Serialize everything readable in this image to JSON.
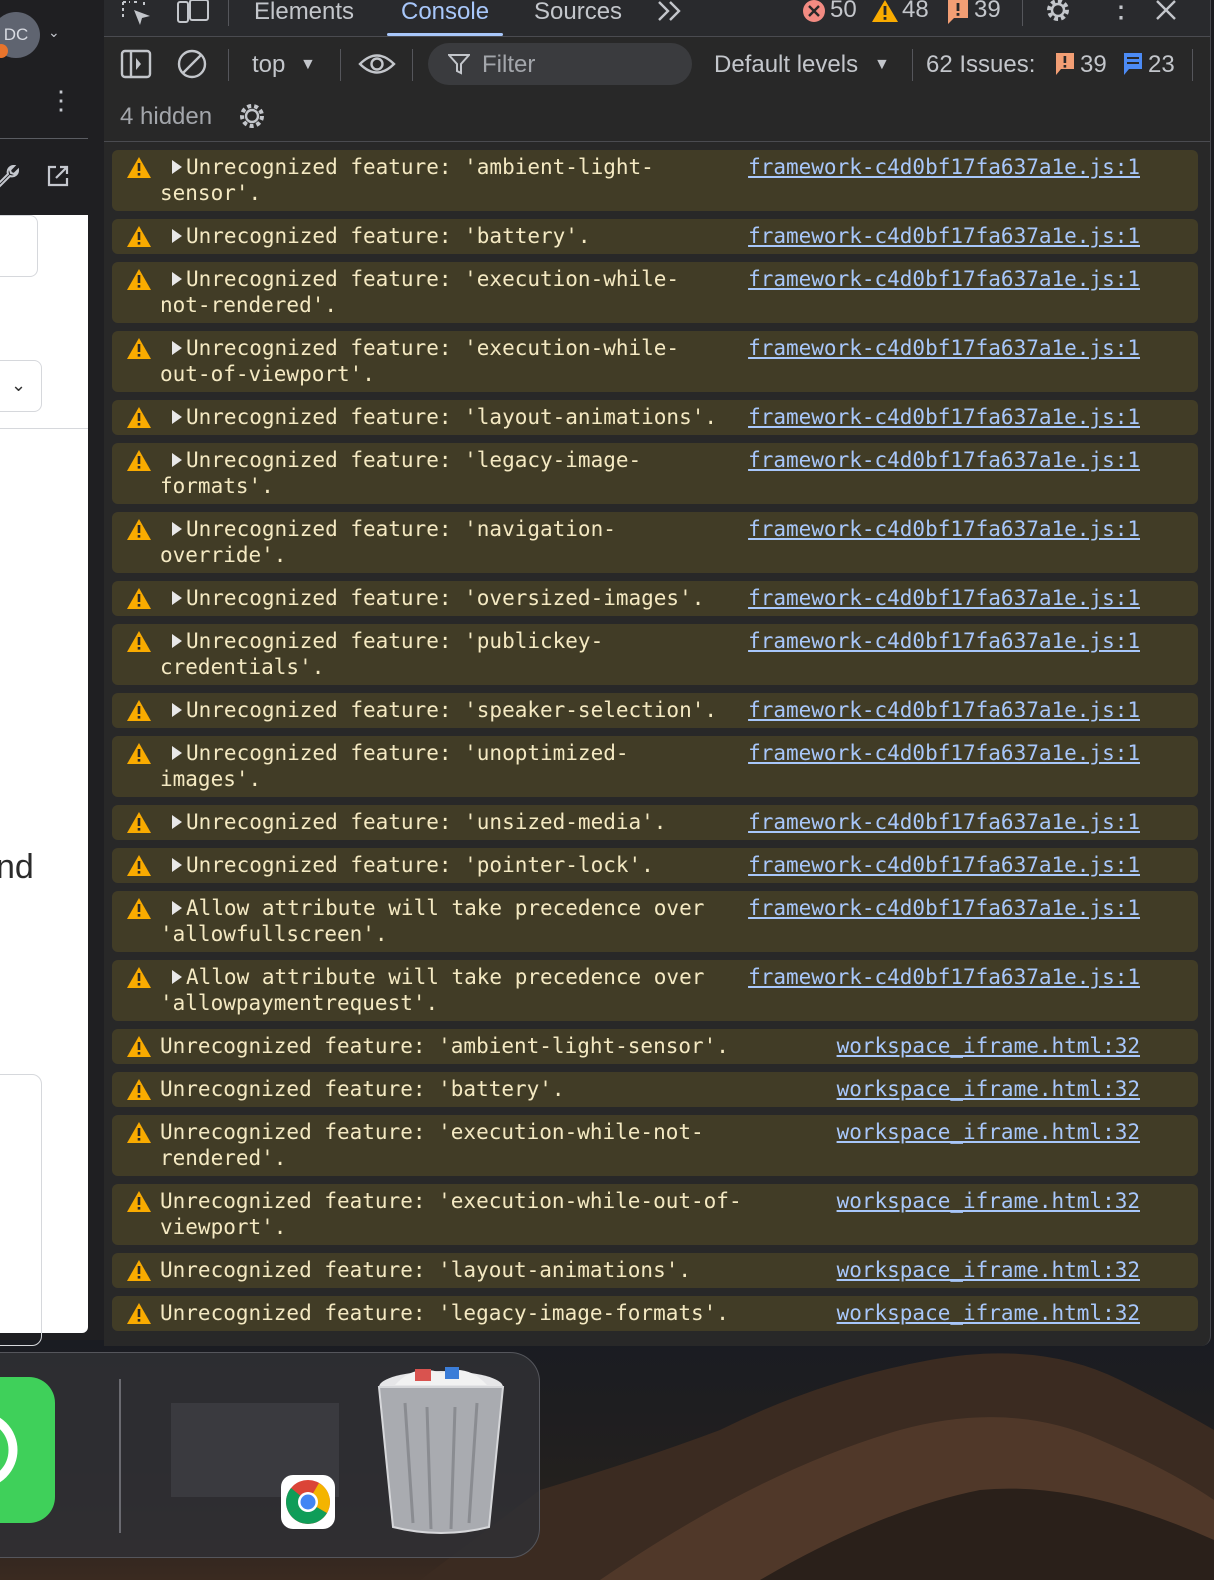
{
  "left_page": {
    "avatar_initials": "DC",
    "text_fragment": "nd"
  },
  "devtools": {
    "tabs": [
      {
        "label": "Elements"
      },
      {
        "label": "Console"
      },
      {
        "label": "Sources"
      }
    ],
    "counts": {
      "errors": "50",
      "warnings": "48",
      "issues": "39"
    },
    "toolbar": {
      "context": "top",
      "filter_placeholder": "Filter",
      "levels": "Default levels",
      "issues_label": "62 Issues:",
      "issues_warnings": "39",
      "issues_info": "23"
    },
    "hidden_label": "4 hidden"
  },
  "messages": [
    {
      "text": "Unrecognized feature: 'ambient-light-sensor'.",
      "source": "framework-c4d0bf17fa637a1e.js:1"
    },
    {
      "text": "Unrecognized feature: 'battery'.",
      "source": "framework-c4d0bf17fa637a1e.js:1"
    },
    {
      "text": "Unrecognized feature: 'execution-while-not-rendered'.",
      "source": "framework-c4d0bf17fa637a1e.js:1"
    },
    {
      "text": "Unrecognized feature: 'execution-while-out-of-viewport'.",
      "source": "framework-c4d0bf17fa637a1e.js:1"
    },
    {
      "text": "Unrecognized feature: 'layout-animations'.",
      "source": "framework-c4d0bf17fa637a1e.js:1"
    },
    {
      "text": "Unrecognized feature: 'legacy-image-formats'.",
      "source": "framework-c4d0bf17fa637a1e.js:1"
    },
    {
      "text": "Unrecognized feature: 'navigation-override'.",
      "source": "framework-c4d0bf17fa637a1e.js:1"
    },
    {
      "text": "Unrecognized feature: 'oversized-images'.",
      "source": "framework-c4d0bf17fa637a1e.js:1"
    },
    {
      "text": "Unrecognized feature: 'publickey-credentials'.",
      "source": "framework-c4d0bf17fa637a1e.js:1"
    },
    {
      "text": "Unrecognized feature: 'speaker-selection'.",
      "source": "framework-c4d0bf17fa637a1e.js:1"
    },
    {
      "text": "Unrecognized feature: 'unoptimized-images'.",
      "source": "framework-c4d0bf17fa637a1e.js:1"
    },
    {
      "text": "Unrecognized feature: 'unsized-media'.",
      "source": "framework-c4d0bf17fa637a1e.js:1"
    },
    {
      "text": "Unrecognized feature: 'pointer-lock'.",
      "source": "framework-c4d0bf17fa637a1e.js:1"
    },
    {
      "text": "Allow attribute will take precedence over 'allowfullscreen'.",
      "source": "framework-c4d0bf17fa637a1e.js:1"
    },
    {
      "text": "Allow attribute will take precedence over 'allowpaymentrequest'.",
      "source": "framework-c4d0bf17fa637a1e.js:1"
    },
    {
      "text": "Unrecognized feature: 'ambient-light-sensor'.",
      "source": "workspace_iframe.html:32"
    },
    {
      "text": "Unrecognized feature: 'battery'.",
      "source": "workspace_iframe.html:32"
    },
    {
      "text": "Unrecognized feature: 'execution-while-not-rendered'.",
      "source": "workspace_iframe.html:32"
    },
    {
      "text": "Unrecognized feature: 'execution-while-out-of-viewport'.",
      "source": "workspace_iframe.html:32"
    },
    {
      "text": "Unrecognized feature: 'layout-animations'.",
      "source": "workspace_iframe.html:32"
    },
    {
      "text": "Unrecognized feature: 'legacy-image-formats'.",
      "source": "workspace_iframe.html:32"
    }
  ],
  "colors": {
    "warning_bg": "#413c26",
    "warning_text": "#f4e9c2",
    "warning_icon": "#f9ab00",
    "link": "#a8c7fa",
    "accent": "#a8c7fa",
    "error": "#f28b82"
  }
}
